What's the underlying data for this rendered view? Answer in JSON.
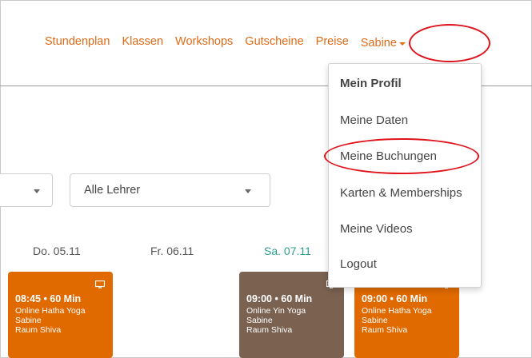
{
  "nav": {
    "items": [
      "Stundenplan",
      "Klassen",
      "Workshops",
      "Gutscheine",
      "Preise"
    ],
    "user_label": "Sabine"
  },
  "filters": {
    "teachers_label": "Alle Lehrer"
  },
  "days": [
    "Do. 05.11",
    "Fr. 06.11",
    "Sa. 07.11"
  ],
  "classes": [
    {
      "time": "08:45 • 60 Min",
      "title": "Online Hatha Yoga",
      "teacher": "Sabine",
      "room": "Raum Shiva",
      "color": "#e06a00"
    },
    {
      "time": "09:00 • 60 Min",
      "title": "Online Yin Yoga",
      "teacher": "Sabine",
      "room": "Raum Shiva",
      "color": "#7a6150"
    },
    {
      "time": "09:00 • 60 Min",
      "title": "Online Hatha Yoga",
      "teacher": "Sabine",
      "room": "Raum Shiva",
      "color": "#e06a00"
    }
  ],
  "menu": {
    "header": "Mein Profil",
    "items": [
      "Meine Daten",
      "Meine Buchungen",
      "Karten & Memberships",
      "Meine Videos",
      "Logout"
    ]
  },
  "colors": {
    "accent": "#e06a16",
    "today": "#2e9b8f",
    "highlight_ring": "#e0131c"
  }
}
